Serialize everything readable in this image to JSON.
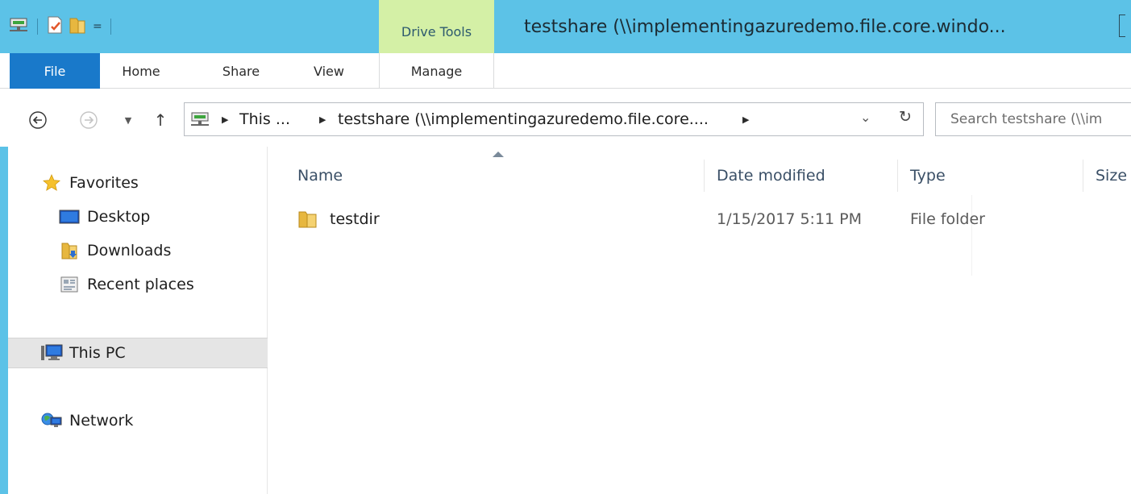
{
  "title_bar": {
    "context_tab_label": "Drive Tools",
    "window_title": "testshare (\\\\implementingazuredemo.file.core.windo...",
    "qat_dropdown": "="
  },
  "ribbon": {
    "tabs": [
      {
        "label": "File"
      },
      {
        "label": "Home"
      },
      {
        "label": "Share"
      },
      {
        "label": "View"
      },
      {
        "label": "Manage"
      }
    ]
  },
  "nav": {
    "recent_dropdown": "▼",
    "up_arrow": "↑",
    "address_crumbs": [
      "This ...",
      "testshare (\\\\implementingazuredemo.file.core...."
    ],
    "address_dropdown": "⌄",
    "refresh": "↻",
    "search_placeholder": "Search testshare (\\\\im"
  },
  "sidebar": {
    "items": [
      {
        "label": "Favorites",
        "icon": "star-icon"
      },
      {
        "label": "Desktop",
        "icon": "desktop-icon"
      },
      {
        "label": "Downloads",
        "icon": "downloads-icon"
      },
      {
        "label": "Recent places",
        "icon": "recent-places-icon"
      },
      {
        "label": "This PC",
        "icon": "computer-icon",
        "selected": true
      },
      {
        "label": "Network",
        "icon": "network-icon"
      }
    ]
  },
  "file_list": {
    "columns": [
      "Name",
      "Date modified",
      "Type",
      "Size"
    ],
    "rows": [
      {
        "name": "testdir",
        "date_modified": "1/15/2017 5:11 PM",
        "type": "File folder",
        "icon": "folder-icon"
      }
    ]
  },
  "colors": {
    "title_bar": "#5cc2e7",
    "context_tab": "#d4f0a6",
    "file_tab": "#1979ca",
    "selected_item": "#e5e5e5"
  }
}
